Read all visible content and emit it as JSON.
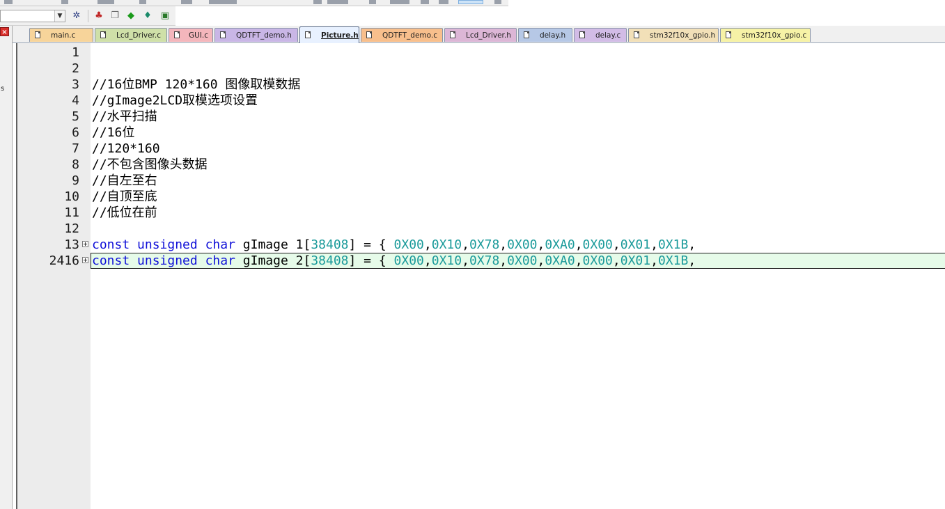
{
  "editor_tabs": [
    {
      "label": "main.c",
      "color": "#f7d49a",
      "active": false
    },
    {
      "label": "Lcd_Driver.c",
      "color": "#cfe0a8",
      "active": false
    },
    {
      "label": "GUI.c",
      "color": "#f4b6bc",
      "active": false
    },
    {
      "label": "QDTFT_demo.h",
      "color": "#c9b6e6",
      "active": false
    },
    {
      "label": "Picture.h",
      "color": "#bfe0d4",
      "active": true
    },
    {
      "label": "QDTFT_demo.c",
      "color": "#f8bf8c",
      "active": false
    },
    {
      "label": "Lcd_Driver.h",
      "color": "#dcb6d6",
      "active": false
    },
    {
      "label": "delay.h",
      "color": "#b6c8e6",
      "active": false
    },
    {
      "label": "delay.c",
      "color": "#d2bce6",
      "active": false
    },
    {
      "label": "stm32f10x_gpio.h",
      "color": "#f2e0b8",
      "active": false
    },
    {
      "label": "stm32f10x_gpio.c",
      "color": "#f6f2a6",
      "active": false
    }
  ],
  "left_panel": {
    "fragment": "s"
  },
  "code_lines": [
    {
      "num": "1",
      "text": ""
    },
    {
      "num": "2",
      "text": ""
    },
    {
      "num": "3",
      "text": "//16位BMP 120*160 图像取模数据"
    },
    {
      "num": "4",
      "text": "//gImage2LCD取模选项设置"
    },
    {
      "num": "5",
      "text": "//水平扫描"
    },
    {
      "num": "6",
      "text": "//16位"
    },
    {
      "num": "7",
      "text": "//120*160"
    },
    {
      "num": "8",
      "text": "//不包含图像头数据"
    },
    {
      "num": "9",
      "text": "//自左至右"
    },
    {
      "num": "10",
      "text": "//自顶至底"
    },
    {
      "num": "11",
      "text": "//低位在前"
    },
    {
      "num": "12",
      "text": ""
    },
    {
      "num": "13",
      "text": "const unsigned char gImage 1[38408] = { 0X00,0X10,0X78,0X00,0XA0,0X00,0X01,0X1B,"
    },
    {
      "num": "2416",
      "text": "const unsigned char gImage 2[38408] = { 0X00,0X10,0X78,0X00,0XA0,0X00,0X01,0X1B,"
    }
  ],
  "colors": {
    "comment": "#2a8a2a",
    "keyword": "#1010d8",
    "number": "#1a9a9a",
    "current_line": "#e6fbe9"
  }
}
